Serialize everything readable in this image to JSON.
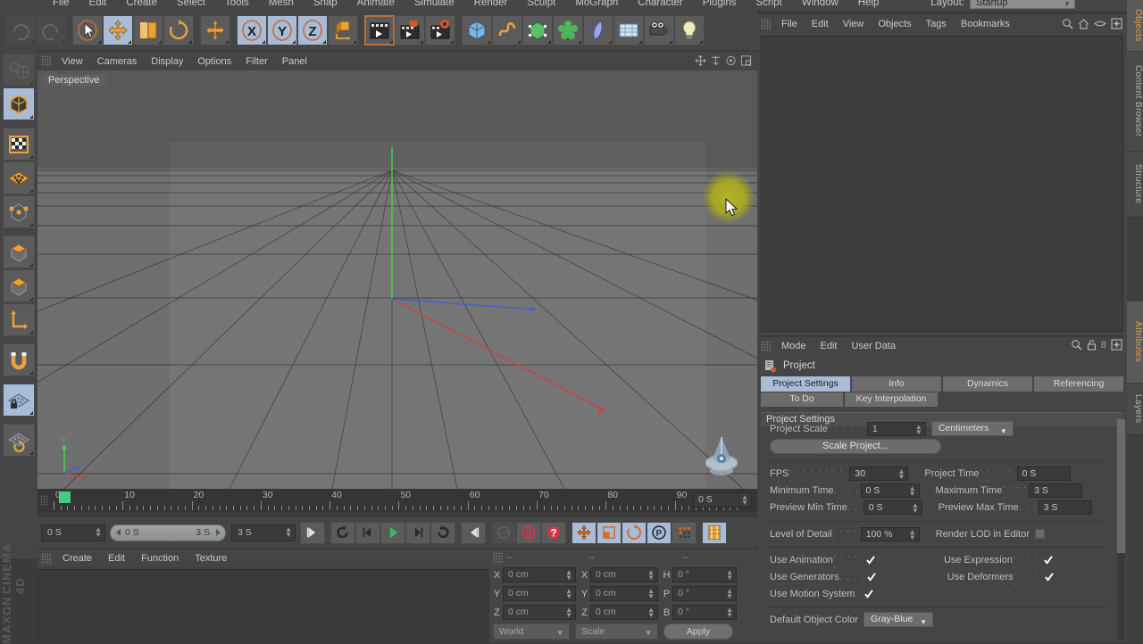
{
  "app": {
    "name": "CINEMA 4D",
    "vendor": "MAXON"
  },
  "menubar": {
    "items": [
      "File",
      "Edit",
      "Create",
      "Select",
      "Tools",
      "Mesh",
      "Snap",
      "Animate",
      "Simulate",
      "Render",
      "Sculpt",
      "MoGraph",
      "Character",
      "Plugins",
      "Script",
      "Window",
      "Help"
    ],
    "layout_label": "Layout:",
    "layout_value": "Startup"
  },
  "toolbar": {
    "groups": [
      {
        "buttons": [
          {
            "name": "undo",
            "icon": "undo-icon",
            "state": "disabled"
          },
          {
            "name": "redo",
            "icon": "redo-icon",
            "state": "disabled"
          }
        ]
      },
      {
        "buttons": [
          {
            "name": "live-selection",
            "icon": "live-selection-icon",
            "state": "normal"
          },
          {
            "name": "move",
            "icon": "move-icon",
            "state": "selected"
          },
          {
            "name": "scale",
            "icon": "scale-icon",
            "state": "normal"
          },
          {
            "name": "rotate",
            "icon": "rotate-icon",
            "state": "normal"
          }
        ]
      },
      {
        "buttons": [
          {
            "name": "move-tool-2",
            "icon": "move-plus-icon",
            "state": "normal"
          }
        ]
      },
      {
        "buttons": [
          {
            "name": "lock-x-axis",
            "icon": "axis-x-icon",
            "state": "selected"
          },
          {
            "name": "lock-y-axis",
            "icon": "axis-y-icon",
            "state": "selected"
          },
          {
            "name": "lock-z-axis",
            "icon": "axis-z-icon",
            "state": "selected"
          },
          {
            "name": "world-object-coordinate",
            "icon": "world-axis-icon",
            "state": "normal"
          }
        ]
      },
      {
        "buttons": [
          {
            "name": "render-view",
            "icon": "render-view-icon",
            "state": "highlighted"
          },
          {
            "name": "render-to-picture-viewer",
            "icon": "render-picture-icon",
            "state": "normal"
          },
          {
            "name": "render-settings",
            "icon": "render-settings-icon",
            "state": "normal"
          }
        ]
      },
      {
        "buttons": [
          {
            "name": "add-cube-object",
            "icon": "cube-icon",
            "state": "normal"
          },
          {
            "name": "add-spline",
            "icon": "spline-icon",
            "state": "normal"
          },
          {
            "name": "add-generator",
            "icon": "generator-icon",
            "state": "normal"
          },
          {
            "name": "add-mograph",
            "icon": "mograph-icon",
            "state": "normal"
          },
          {
            "name": "add-deformer",
            "icon": "deformer-icon",
            "state": "normal"
          },
          {
            "name": "add-environment",
            "icon": "environment-icon",
            "state": "normal"
          },
          {
            "name": "add-camera",
            "icon": "camera-icon",
            "state": "normal"
          },
          {
            "name": "add-light",
            "icon": "light-icon",
            "state": "normal"
          }
        ]
      }
    ]
  },
  "left_toolbar": {
    "buttons": [
      {
        "name": "make-editable",
        "icon": "make-editable-icon",
        "state": "disabled"
      },
      {
        "name": "model-mode",
        "icon": "model-cube-icon",
        "state": "selected"
      },
      {
        "name": "texture-mode",
        "icon": "texture-checker-icon",
        "state": "normal"
      },
      {
        "name": "points-mode",
        "icon": "points-grid-icon",
        "state": "normal"
      },
      {
        "name": "edges-mode",
        "icon": "edges-icon",
        "state": "normal"
      },
      {
        "name": "polygons-mode",
        "icon": "polygons-icon",
        "state": "normal"
      },
      {
        "name": "object-axis-mode",
        "icon": "object-axis-icon",
        "state": "normal"
      },
      {
        "name": "axis-tool",
        "icon": "axis-arrow-icon",
        "state": "normal"
      },
      {
        "name": "enable-snapping",
        "icon": "magnet-icon",
        "state": "normal"
      },
      {
        "name": "workplane-lock",
        "icon": "workplane-lock-icon",
        "state": "selected"
      },
      {
        "name": "workplane-rotate",
        "icon": "workplane-rotate-icon",
        "state": "normal"
      }
    ]
  },
  "viewport": {
    "menu": [
      "View",
      "Cameras",
      "Display",
      "Options",
      "Filter",
      "Panel"
    ],
    "label": "Perspective",
    "corner_icons": [
      "pan-icon",
      "dolly-icon",
      "orbit-icon",
      "maximize-icon"
    ],
    "axis_labels": {
      "x": "X",
      "y": "Y",
      "z": "Z"
    },
    "colors": {
      "x_axis": "#cc3b3b",
      "y_axis": "#3ecf4a",
      "z_axis": "#3a5fd0",
      "glow": "#b3b31e"
    }
  },
  "timeline": {
    "ticks": [
      0,
      10,
      20,
      30,
      40,
      50,
      60,
      70,
      80,
      90
    ],
    "current_frame_field": "0 S",
    "playhead_frame": 0
  },
  "playback": {
    "current_time": "0 S",
    "range_start": "0 S",
    "range_end": "3 S",
    "end_time": "3 S",
    "buttons": [
      {
        "name": "go-to-start",
        "icon": "skip-start-icon",
        "state": "normal"
      },
      {
        "name": "previous-key",
        "icon": "previous-key-icon",
        "state": "normal"
      },
      {
        "name": "step-back",
        "icon": "step-back-icon",
        "state": "normal"
      },
      {
        "name": "play",
        "icon": "play-icon",
        "state": "normal"
      },
      {
        "name": "step-forward",
        "icon": "step-forward-icon",
        "state": "normal"
      },
      {
        "name": "next-key",
        "icon": "next-key-icon",
        "state": "normal"
      },
      {
        "name": "go-to-end",
        "icon": "skip-end-icon",
        "state": "normal"
      },
      {
        "name": "record-active-objects",
        "icon": "record-disabled-icon",
        "state": "disabled"
      },
      {
        "name": "autokeying",
        "icon": "autokey-icon",
        "state": "normal"
      },
      {
        "name": "keyframe-selection",
        "icon": "question-icon",
        "state": "normal"
      },
      {
        "name": "position-key",
        "icon": "position-key-icon",
        "state": "selected"
      },
      {
        "name": "scale-key",
        "icon": "scale-key-icon",
        "state": "selected"
      },
      {
        "name": "rotation-key",
        "icon": "rotation-key-icon",
        "state": "selected"
      },
      {
        "name": "parameter-key",
        "icon": "param-key-icon",
        "state": "selected"
      },
      {
        "name": "point-level-animation",
        "icon": "pla-icon",
        "state": "normal"
      },
      {
        "name": "timeline-toggle",
        "icon": "timeline-icon",
        "state": "selected"
      }
    ]
  },
  "material_manager": {
    "menu": [
      "Create",
      "Edit",
      "Function",
      "Texture"
    ]
  },
  "coordinates": {
    "header_dashes": [
      "--",
      "--",
      "--"
    ],
    "rows": [
      {
        "pos_label": "X",
        "pos_value": "0 cm",
        "size_label": "X",
        "size_value": "0 cm",
        "rot_label": "H",
        "rot_value": "0 °"
      },
      {
        "pos_label": "Y",
        "pos_value": "0 cm",
        "size_label": "Y",
        "size_value": "0 cm",
        "rot_label": "P",
        "rot_value": "0 °"
      },
      {
        "pos_label": "Z",
        "pos_value": "0 cm",
        "size_label": "Z",
        "size_value": "0 cm",
        "rot_label": "B",
        "rot_value": "0 °"
      }
    ],
    "system": "World",
    "mode": "Scale",
    "apply_label": "Apply"
  },
  "objects_manager": {
    "menu": [
      "File",
      "Edit",
      "View",
      "Objects",
      "Tags",
      "Bookmarks"
    ],
    "icons": [
      "search-icon",
      "home-icon",
      "eye-icon",
      "add-icon"
    ]
  },
  "attributes": {
    "menu": [
      "Mode",
      "Edit",
      "User Data"
    ],
    "icons": [
      "search-icon",
      "lock-icon",
      "history-count",
      "pin-icon"
    ],
    "history_count": "8",
    "title": "Project",
    "title_icon": "project-icon",
    "tabs": [
      "Project Settings",
      "Info",
      "Dynamics",
      "Referencing"
    ],
    "tabs_row2": [
      "To Do",
      "Key Interpolation"
    ],
    "active_tab": "Project Settings",
    "section_title": "Project Settings",
    "fields": {
      "project_scale_label": "Project Scale",
      "project_scale_value": "1",
      "project_scale_unit": "Centimeters",
      "scale_project_button": "Scale Project...",
      "fps_label": "FPS",
      "fps_value": "30",
      "project_time_label": "Project Time",
      "project_time_value": "0 S",
      "minimum_time_label": "Minimum Time",
      "minimum_time_value": "0 S",
      "maximum_time_label": "Maximum Time",
      "maximum_time_value": "3 S",
      "preview_min_label": "Preview Min Time",
      "preview_min_value": "0 S",
      "preview_max_label": "Preview Max Time",
      "preview_max_value": "3 S",
      "lod_label": "Level of Detail",
      "lod_value": "100 %",
      "render_lod_label": "Render LOD in Editor",
      "render_lod_checked": false,
      "use_animation_label": "Use Animation",
      "use_animation_checked": true,
      "use_expression_label": "Use Expression",
      "use_expression_checked": true,
      "use_generators_label": "Use Generators",
      "use_generators_checked": true,
      "use_deformers_label": "Use Deformers",
      "use_deformers_checked": true,
      "use_motion_label": "Use Motion System",
      "use_motion_checked": true,
      "default_color_label": "Default Object Color",
      "default_color_value": "Gray-Blue"
    }
  },
  "right_tabs": [
    {
      "label": "Objects",
      "active": true
    },
    {
      "label": "Content Browser",
      "active": false
    },
    {
      "label": "Structure",
      "active": false
    },
    {
      "label": "Attributes",
      "active": true
    },
    {
      "label": "Layers",
      "active": false
    }
  ]
}
